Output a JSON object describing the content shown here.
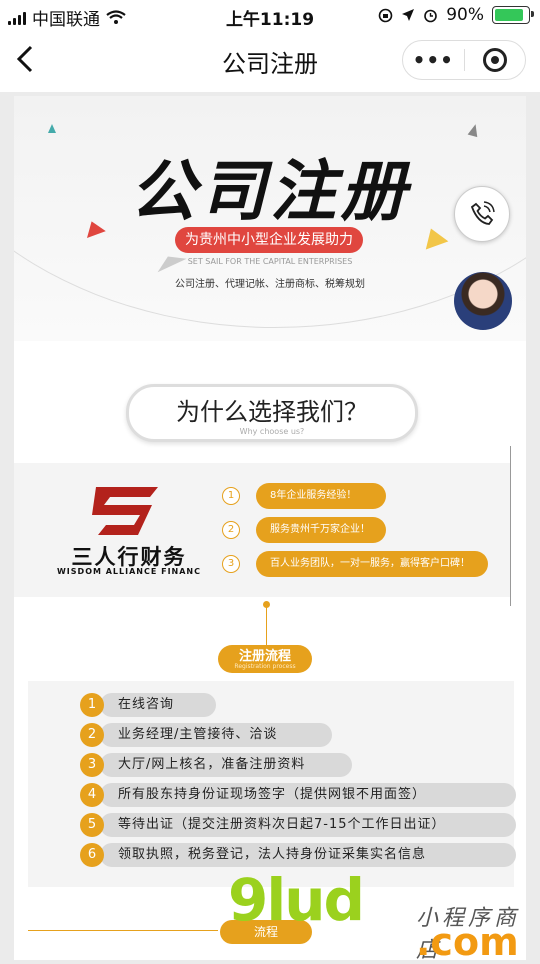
{
  "status_bar": {
    "carrier": "中国联通",
    "time": "上午11:19",
    "battery": "90%"
  },
  "nav": {
    "back_icon": "chevron-left",
    "title": "公司注册",
    "more": "•••"
  },
  "hero": {
    "title": "公司注册",
    "ribbon": "为贵州中小型企业发展助力",
    "tagline_en": "SET SAIL FOR THE CAPITAL ENTERPRISES",
    "services": "公司注册、代理记帐、注册商标、税筹规划"
  },
  "why": {
    "title": "为什么选择我们？",
    "subtitle": "Why choose us?",
    "company_name": "三人行财务",
    "company_en": "WISDOM ALLIANCE FINANC",
    "items": [
      {
        "num": "1",
        "text": "8年企业服务经验！"
      },
      {
        "num": "2",
        "text": "服务贵州千万家企业！"
      },
      {
        "num": "3",
        "text": "百人业务团队，一对一服务，赢得客户口碑！"
      }
    ]
  },
  "registration": {
    "tag": "注册流程",
    "tag_en": "Registration process",
    "steps": [
      {
        "num": "1",
        "text": "在线咨询"
      },
      {
        "num": "2",
        "text": "业务经理/主管接待、洽谈"
      },
      {
        "num": "3",
        "text": "大厅/网上核名，准备注册资料"
      },
      {
        "num": "4",
        "text": "所有股东持身份证现场签字（提供网银不用面签）"
      },
      {
        "num": "5",
        "text": "等待出证（提交注册资料次日起7-15个工作日出证）"
      },
      {
        "num": "6",
        "text": "领取执照，税务登记，法人持身份证采集实名信息"
      }
    ]
  },
  "next_tag": "流程",
  "watermark": {
    "brand": "9lud",
    "domain": ".com",
    "cn": "小程序商店"
  },
  "colors": {
    "accent": "#e6a11d",
    "ribbon_red": "#e0463f",
    "battery_green": "#34c759"
  }
}
